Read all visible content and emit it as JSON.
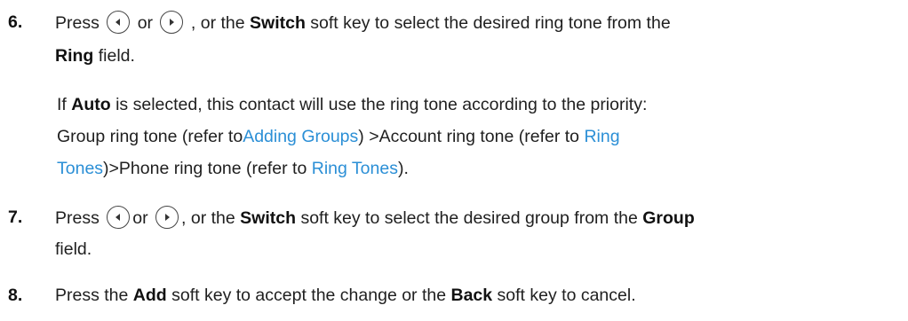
{
  "step6": {
    "number": "6.",
    "press": "Press",
    "or": "or",
    "after_right": ", or the",
    "switch": "Switch",
    "rest1": "soft key to select the desired ring tone from the",
    "ring": "Ring",
    "field": "field.",
    "note_if": "If",
    "note_auto": "Auto",
    "note_rest": "is selected, this contact will use the ring tone according to the priority:",
    "group_text": "Group ring tone (refer to",
    "link_adding_groups": "Adding Groups",
    "account_text": ") >Account ring tone (refer to",
    "link_ring_1": "Ring",
    "link_tones_1": "Tones",
    "phone_text": ")>Phone ring tone (refer to",
    "link_ring_tones_2": "Ring Tones",
    "end_text": ")."
  },
  "step7": {
    "number": "7.",
    "press": "Press",
    "or": "or",
    "after_right": ", or the",
    "switch": "Switch",
    "rest1": "soft key to select the desired group from the",
    "group": "Group",
    "field": "field."
  },
  "step8": {
    "number": "8.",
    "press_the": "Press the",
    "add": "Add",
    "mid": "soft key to accept the change or the",
    "back": "Back",
    "end": "soft key to cancel."
  },
  "icons": {
    "left": "left-arrow-key-icon",
    "right": "right-arrow-key-icon"
  }
}
